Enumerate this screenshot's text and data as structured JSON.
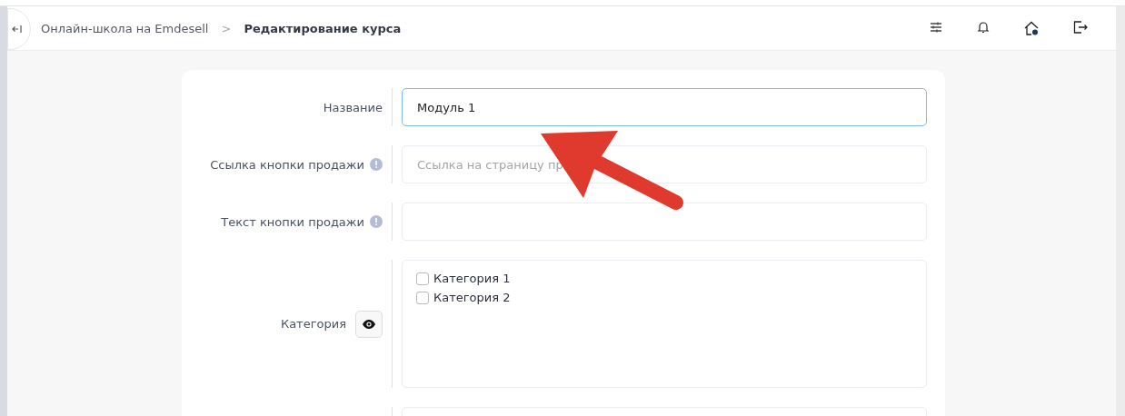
{
  "header": {
    "breadcrumbs": [
      {
        "label": "Онлайн-школа на Emdesell",
        "current": false
      },
      {
        "label": "Редактирование курса",
        "current": true
      }
    ],
    "separator": ">"
  },
  "form": {
    "rows": [
      {
        "kind": "input",
        "label": "Название",
        "value": "Модуль 1",
        "focused": true,
        "info": false
      },
      {
        "kind": "input",
        "label": "Ссылка кнопки продажи",
        "placeholder": "Ссылка на страницу пр",
        "focused": false,
        "info": true
      },
      {
        "kind": "input",
        "label": "Текст кнопки продажи",
        "focused": false,
        "info": true
      },
      {
        "kind": "checklist",
        "label": "Категория",
        "info": false,
        "options": [
          {
            "label": "Категория 1",
            "checked": false
          },
          {
            "label": "Категория 2",
            "checked": false
          }
        ]
      },
      {
        "kind": "input",
        "focused": false,
        "info": false
      }
    ]
  }
}
